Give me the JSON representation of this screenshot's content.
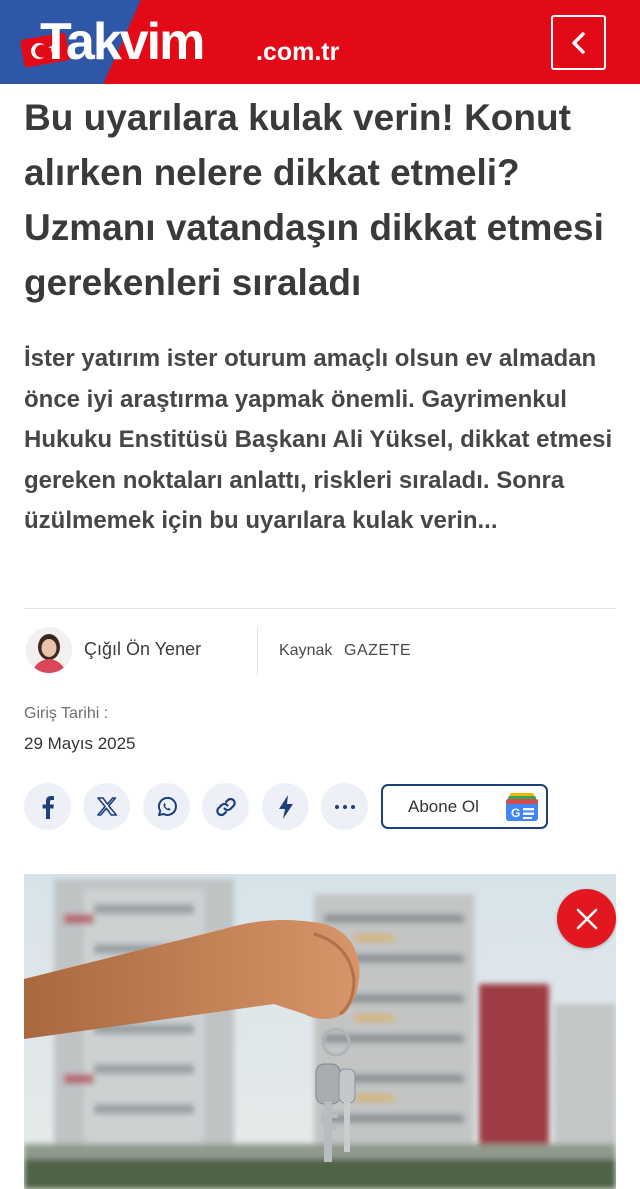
{
  "header": {
    "brand": "Takvim",
    "brand_suffix": ".com.tr",
    "colors": {
      "red": "#e30a17",
      "blue": "#2e57a8"
    },
    "back_icon": "chevron-left-icon"
  },
  "article": {
    "headline": "Bu uyarılara kulak verin! Konut alırken nelere dikkat etmeli? Uzmanı vatandaşın dikkat etmesi gerekenleri sıraladı",
    "lead": "İster yatırım ister oturum amaçlı olsun ev almadan önce iyi araştırma yapmak önemli. Gayrimenkul Hukuku Enstitüsü Başkanı Ali Yüksel, dikkat etmesi gereken noktaları anlattı, riskleri sıraladı. Sonra üzülmemek için bu uyarılara kulak verin...",
    "author": "Çığıl Ön Yener",
    "source_label": "Kaynak",
    "source_value": "GAZETE",
    "date_label": "Giriş Tarihi :",
    "date_value": "29 Mayıs 2025"
  },
  "share": {
    "buttons": [
      "facebook-icon",
      "x-icon",
      "whatsapp-icon",
      "link-icon",
      "flash-icon",
      "more-icon"
    ],
    "subscribe_label": "Abone Ol"
  },
  "hero": {
    "close_icon": "close-icon"
  }
}
